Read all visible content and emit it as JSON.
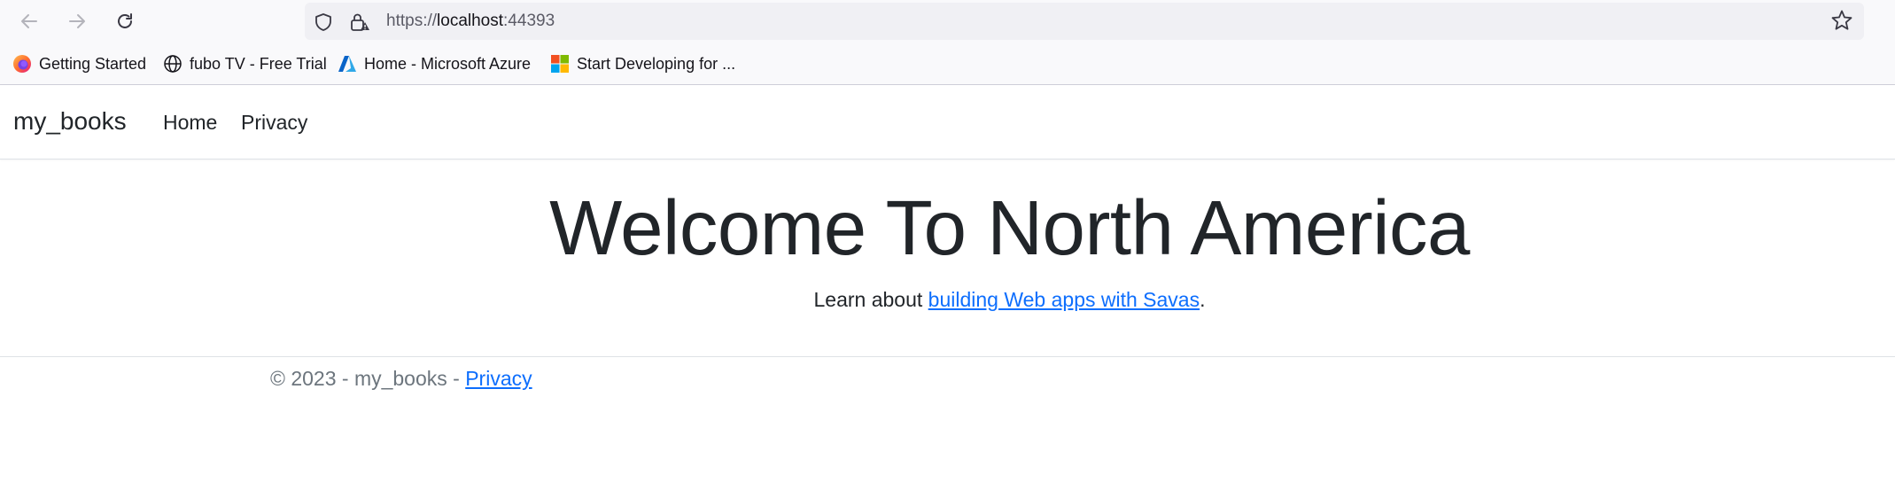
{
  "browser": {
    "url_scheme": "https://",
    "url_host": "localhost",
    "url_port": ":44393",
    "bookmarks": [
      {
        "label": "Getting Started",
        "icon": "firefox-icon"
      },
      {
        "label": "fubo TV - Free Trial",
        "icon": "globe-icon"
      },
      {
        "label": "Home - Microsoft Azure",
        "icon": "azure-icon"
      },
      {
        "label": "Start Developing for ...",
        "icon": "microsoft-icon"
      }
    ]
  },
  "navbar": {
    "brand": "my_books",
    "links": [
      "Home",
      "Privacy"
    ]
  },
  "main": {
    "title": "Welcome To North America",
    "lead_prefix": "Learn about ",
    "lead_link": "building Web apps with Savas",
    "lead_suffix": "."
  },
  "footer": {
    "text": "© 2023 - my_books - ",
    "privacy_link": "Privacy"
  },
  "colors": {
    "link": "#0d6efd",
    "text": "#212529",
    "muted": "#6c757d"
  }
}
